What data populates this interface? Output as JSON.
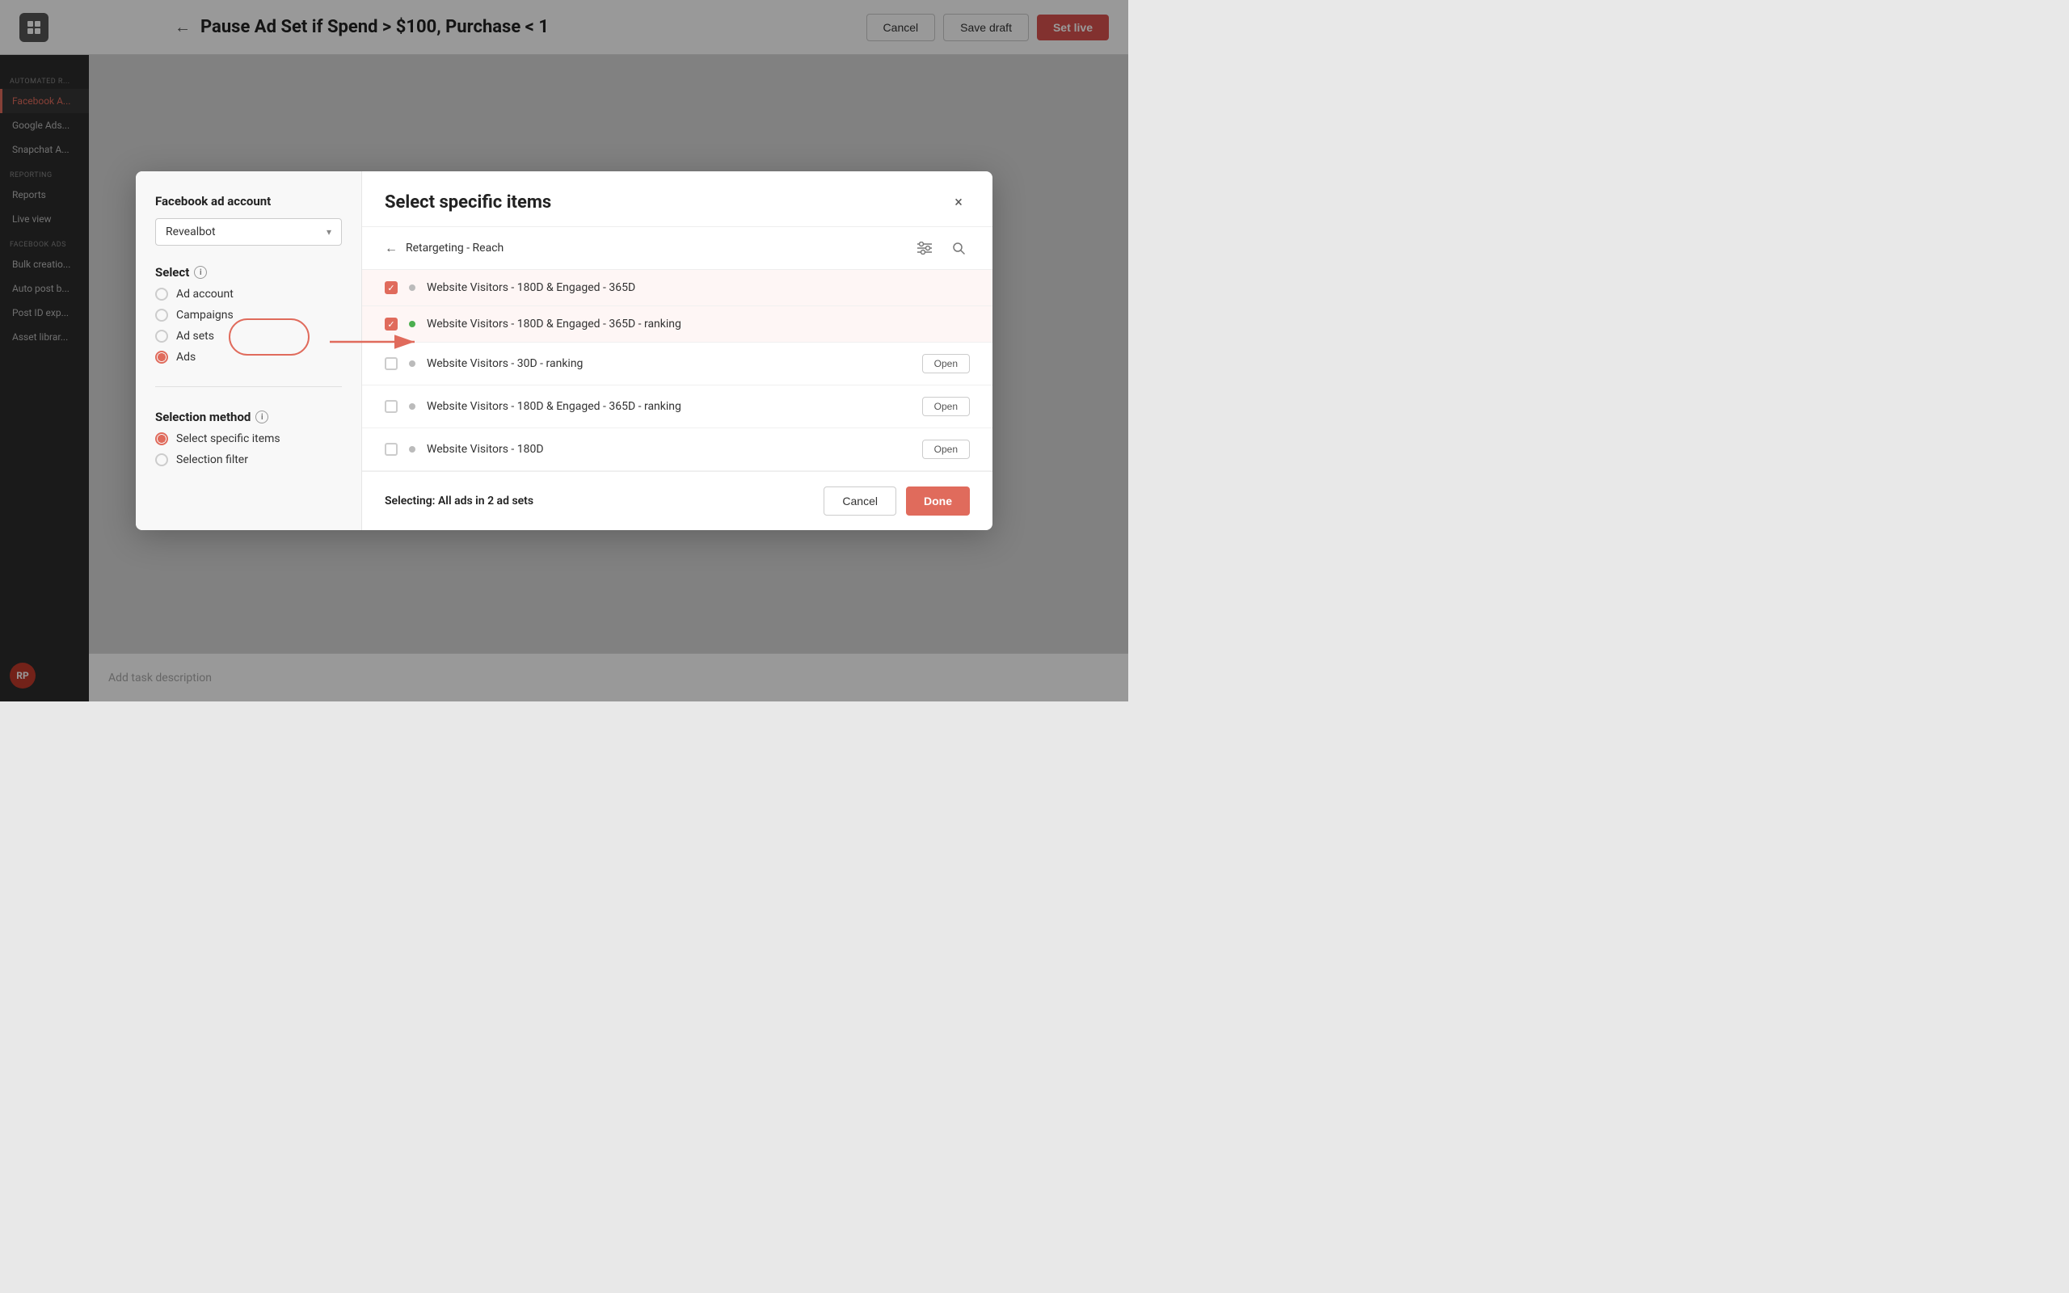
{
  "header": {
    "back_arrow": "←",
    "title": "Pause Ad Set if Spend > $100, Purchase < 1",
    "cancel_label": "Cancel",
    "save_draft_label": "Save draft",
    "set_live_label": "Set live"
  },
  "sidebar": {
    "automated_rules_label": "AUTOMATED R...",
    "facebook_ads_label": "Facebook A...",
    "google_ads_label": "Google Ads...",
    "snapchat_ads_label": "Snapchat A...",
    "reporting_label": "REPORTING",
    "reports_label": "Reports",
    "live_view_label": "Live view",
    "facebook_ads_section": "FACEBOOK ADS",
    "bulk_creation_label": "Bulk creatio...",
    "auto_post_label": "Auto post b...",
    "post_id_exp_label": "Post ID exp...",
    "asset_library_label": "Asset librar...",
    "avatar_initials": "RP"
  },
  "modal_left": {
    "fb_account_section": "Facebook ad account",
    "fb_account_value": "Revealbot",
    "select_label": "Select",
    "info_icon": "i",
    "radio_options": [
      {
        "id": "ad-account",
        "label": "Ad account",
        "active": false
      },
      {
        "id": "campaigns",
        "label": "Campaigns",
        "active": false
      },
      {
        "id": "ad-sets",
        "label": "Ad sets",
        "active": false
      },
      {
        "id": "ads",
        "label": "Ads",
        "active": true
      }
    ],
    "selection_method_label": "Selection method",
    "selection_method_options": [
      {
        "id": "select-specific",
        "label": "Select specific items",
        "active": true
      },
      {
        "id": "selection-filter",
        "label": "Selection filter",
        "active": false
      }
    ]
  },
  "modal_right": {
    "title": "Select specific items",
    "close_icon": "×",
    "breadcrumb_back": "←",
    "breadcrumb_text": "Retargeting - Reach",
    "filter_icon": "⚙",
    "search_icon": "🔍",
    "items": [
      {
        "id": 1,
        "checked": true,
        "dot_color": "gray",
        "name": "Website Visitors - 180D & Engaged - 365D",
        "has_open": false,
        "selected_bg": true
      },
      {
        "id": 2,
        "checked": true,
        "dot_color": "green",
        "name": "Website Visitors - 180D & Engaged - 365D - ranking",
        "has_open": false,
        "selected_bg": true
      },
      {
        "id": 3,
        "checked": false,
        "dot_color": "gray",
        "name": "Website Visitors - 30D - ranking",
        "has_open": true,
        "selected_bg": false
      },
      {
        "id": 4,
        "checked": false,
        "dot_color": "gray",
        "name": "Website Visitors - 180D & Engaged - 365D - ranking",
        "has_open": true,
        "selected_bg": false
      },
      {
        "id": 5,
        "checked": false,
        "dot_color": "gray",
        "name": "Website Visitors - 180D",
        "has_open": true,
        "selected_bg": false
      }
    ],
    "open_btn_label": "Open",
    "footer_status": "Selecting: All ads in 2 ad sets",
    "cancel_label": "Cancel",
    "done_label": "Done"
  },
  "task_bar": {
    "placeholder": "Add task description"
  }
}
